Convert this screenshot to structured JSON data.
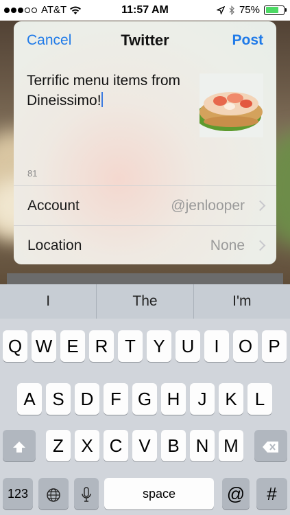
{
  "status_bar": {
    "carrier": "AT&T",
    "time": "11:57 AM",
    "battery": "75%",
    "signal_dots_filled": 3,
    "signal_dots_total": 5
  },
  "sheet": {
    "cancel_label": "Cancel",
    "title": "Twitter",
    "post_label": "Post",
    "message": "Terrific menu items from Dineissimo!",
    "char_count": "81",
    "account_label": "Account",
    "account_value": "@jenlooper",
    "location_label": "Location",
    "location_value": "None"
  },
  "keyboard": {
    "predictions": [
      "I",
      "The",
      "I'm"
    ],
    "row1": [
      "Q",
      "W",
      "E",
      "R",
      "T",
      "Y",
      "U",
      "I",
      "O",
      "P"
    ],
    "row2": [
      "A",
      "S",
      "D",
      "F",
      "G",
      "H",
      "J",
      "K",
      "L"
    ],
    "row3": [
      "Z",
      "X",
      "C",
      "V",
      "B",
      "N",
      "M"
    ],
    "numbers_label": "123",
    "space_label": "space",
    "at_label": "@",
    "hash_label": "#"
  },
  "colors": {
    "accent": "#1f7ae8",
    "battery": "#4cd964"
  }
}
